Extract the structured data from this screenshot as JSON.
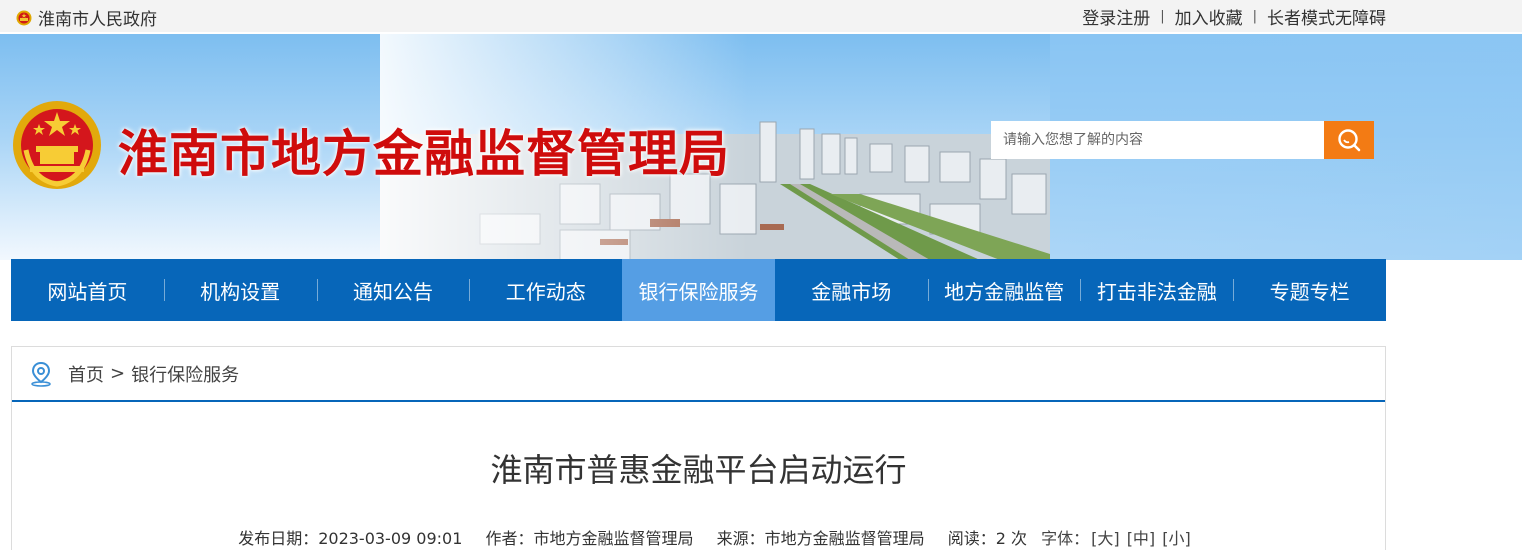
{
  "topbar": {
    "gov_link": "淮南市人民政府",
    "login": "登录",
    "register": "注册",
    "favorite": "加入收藏",
    "elder_mode": "长者模式",
    "accessibility": "无障碍"
  },
  "header": {
    "site_title": "淮南市地方金融监督管理局",
    "search_placeholder": "请输入您想了解的内容",
    "search_icon": "search-icon",
    "brand_color": "#cf0c0c",
    "accent_color": "#f37b14"
  },
  "nav": {
    "items": [
      {
        "label": "网站首页"
      },
      {
        "label": "机构设置"
      },
      {
        "label": "通知公告"
      },
      {
        "label": "工作动态"
      },
      {
        "label": "银行保险服务"
      },
      {
        "label": "金融市场"
      },
      {
        "label": "地方金融监管"
      },
      {
        "label": "打击非法金融"
      },
      {
        "label": "专题专栏"
      }
    ],
    "active_index": 4,
    "color": "#0766b9",
    "active_color": "#559ee4"
  },
  "breadcrumb": {
    "home": "首页",
    "separator": ">",
    "current": "银行保险服务"
  },
  "article": {
    "title": "淮南市普惠金融平台启动运行",
    "date_label": "发布日期：2023-03-09 09:01",
    "author_label": "作者：市地方金融监督管理局",
    "source_label": "来源：市地方金融监督管理局",
    "reads_label": "阅读：2 次",
    "font_label": "字体：",
    "font_large": "[大]",
    "font_medium": "[中]",
    "font_small": "[小]"
  }
}
